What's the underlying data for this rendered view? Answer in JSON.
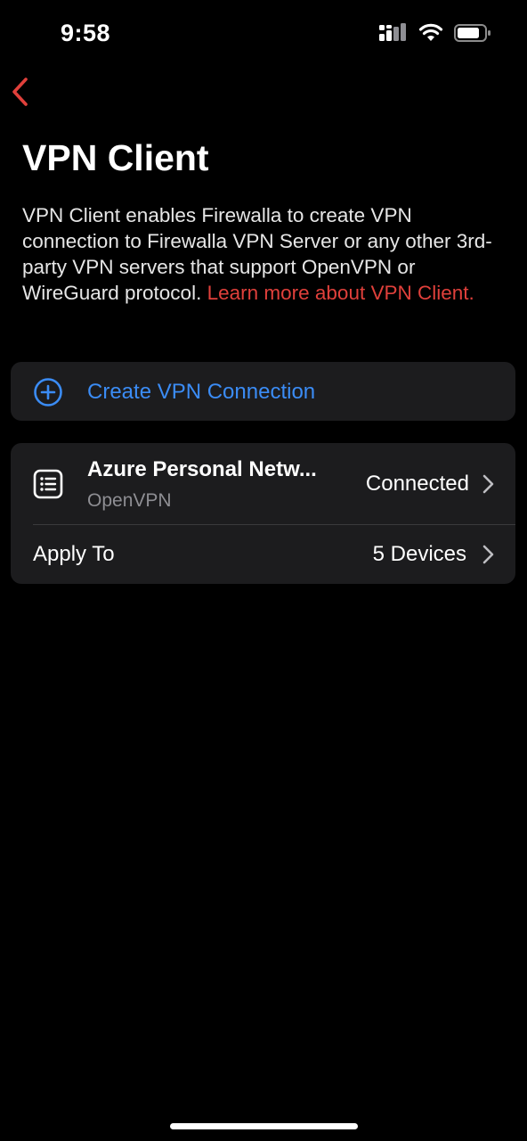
{
  "status_bar": {
    "time": "9:58"
  },
  "nav": {
    "back_icon": "chevron-left-icon"
  },
  "page": {
    "title": "VPN Client",
    "description": "VPN Client enables Firewalla to create VPN connection to Firewalla VPN Server or any other 3rd-party VPN servers that support OpenVPN or WireGuard protocol.",
    "learn_more_link": "Learn more about VPN Client."
  },
  "create": {
    "label": "Create VPN Connection",
    "icon": "plus-circle-icon"
  },
  "connection": {
    "name": "Azure Personal Netw...",
    "type": "OpenVPN",
    "status": "Connected",
    "icon": "list-icon"
  },
  "apply_to": {
    "label": "Apply To",
    "value": "5 Devices"
  },
  "colors": {
    "accent_red": "#e0403b",
    "accent_blue": "#3b8cf5",
    "card_bg": "#1c1c1e"
  }
}
